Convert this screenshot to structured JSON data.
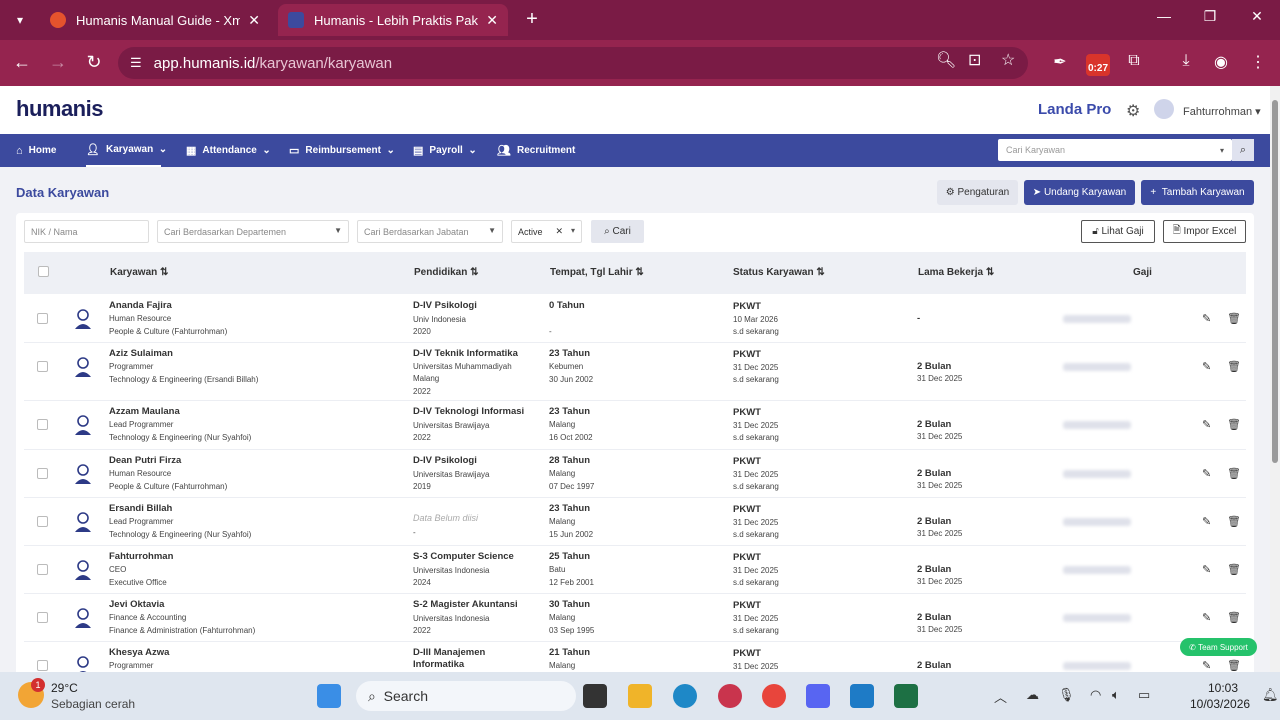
{
  "browser": {
    "tabs": [
      {
        "title": "Humanis Manual Guide - Xmind"
      },
      {
        "title": "Humanis - Lebih Praktis Pakai Humanis"
      }
    ],
    "url_domain": "app.humanis.id",
    "url_path": "/karyawan/karyawan",
    "ext_badge": "0:27"
  },
  "app": {
    "logo": "humanis",
    "company": "Landa Pro",
    "user": "Fahturrohman"
  },
  "nav": {
    "items": [
      "Home",
      "Karyawan",
      "Attendance",
      "Reimbursement",
      "Payroll",
      "Recruitment"
    ],
    "search_placeholder": "Cari Karyawan"
  },
  "page": {
    "title": "Data Karyawan",
    "btn_settings": "Pengaturan",
    "btn_invite": "Undang Karyawan",
    "btn_add": "Tambah Karyawan"
  },
  "filters": {
    "nik_placeholder": "NIK / Nama",
    "dept_placeholder": "Cari Berdasarkan Departemen",
    "job_placeholder": "Cari Berdasarkan Jabatan",
    "status_value": "Active",
    "search_btn": "Cari",
    "btn_salary": "Lihat Gaji",
    "btn_import": "Impor Excel"
  },
  "table": {
    "headers": [
      "Karyawan",
      "Pendidikan",
      "Tempat, Tgl Lahir",
      "Status Karyawan",
      "Lama Bekerja",
      "Gaji"
    ],
    "rows": [
      {
        "name": "Ananda Fajira",
        "role": "Human Resource",
        "dept": "People & Culture (Fahturrohman)",
        "edu": "D-IV Psikologi",
        "school": "Univ Indonesia",
        "year": "2020",
        "age": "0 Tahun",
        "city": "",
        "dob": "-",
        "status": "PKWT",
        "status_date": "10 Mar 2026",
        "status_until": "s.d sekarang",
        "tenure": "-",
        "tenure_date": ""
      },
      {
        "name": "Aziz Sulaiman",
        "role": "Programmer",
        "dept": "Technology & Engineering (Ersandi Billah)",
        "edu": "D-IV Teknik Informatika",
        "school": "Universitas Muhammadiyah Malang",
        "year": "2022",
        "age": "23 Tahun",
        "city": "Kebumen",
        "dob": "30 Jun 2002",
        "status": "PKWT",
        "status_date": "31 Dec 2025",
        "status_until": "s.d sekarang",
        "tenure": "2 Bulan",
        "tenure_date": "31 Dec 2025"
      },
      {
        "name": "Azzam Maulana",
        "role": "Lead Programmer",
        "dept": "Technology & Engineering (Nur Syahfoi)",
        "edu": "D-IV Teknologi Informasi",
        "school": "Universitas Brawijaya",
        "year": "2022",
        "age": "23 Tahun",
        "city": "Malang",
        "dob": "16 Oct 2002",
        "status": "PKWT",
        "status_date": "31 Dec 2025",
        "status_until": "s.d sekarang",
        "tenure": "2 Bulan",
        "tenure_date": "31 Dec 2025"
      },
      {
        "name": "Dean Putri Firza",
        "role": "Human Resource",
        "dept": "People & Culture (Fahturrohman)",
        "edu": "D-IV Psikologi",
        "school": "Universitas Brawijaya",
        "year": "2019",
        "age": "28 Tahun",
        "city": "Malang",
        "dob": "07 Dec 1997",
        "status": "PKWT",
        "status_date": "31 Dec 2025",
        "status_until": "s.d sekarang",
        "tenure": "2 Bulan",
        "tenure_date": "31 Dec 2025"
      },
      {
        "name": "Ersandi Billah",
        "role": "Lead Programmer",
        "dept": "Technology & Engineering (Nur Syahfoi)",
        "edu": "",
        "edu_empty": "Data Belum diisi",
        "school": "-",
        "year": "",
        "age": "23 Tahun",
        "city": "Malang",
        "dob": "15 Jun 2002",
        "status": "PKWT",
        "status_date": "31 Dec 2025",
        "status_until": "s.d sekarang",
        "tenure": "2 Bulan",
        "tenure_date": "31 Dec 2025"
      },
      {
        "name": "Fahturrohman",
        "role": "CEO",
        "dept": "Executive Office",
        "edu": "S-3 Computer Science",
        "school": "Universitas Indonesia",
        "year": "2024",
        "age": "25 Tahun",
        "city": "Batu",
        "dob": "12 Feb 2001",
        "status": "PKWT",
        "status_date": "31 Dec 2025",
        "status_until": "s.d sekarang",
        "tenure": "2 Bulan",
        "tenure_date": "31 Dec 2025"
      },
      {
        "name": "Jevi Oktavia",
        "role": "Finance & Accounting",
        "dept": "Finance & Administration (Fahturrohman)",
        "edu": "S-2 Magister Akuntansi",
        "school": "Universitas Indonesia",
        "year": "2022",
        "age": "30 Tahun",
        "city": "Malang",
        "dob": "03 Sep 1995",
        "status": "PKWT",
        "status_date": "31 Dec 2025",
        "status_until": "s.d sekarang",
        "tenure": "2 Bulan",
        "tenure_date": "31 Dec 2025"
      },
      {
        "name": "Khesya Azwa",
        "role": "Programmer",
        "dept": "",
        "edu": "D-III Manajemen Informatika",
        "school": "",
        "year": "",
        "age": "21 Tahun",
        "city": "Malang",
        "dob": "",
        "status": "PKWT",
        "status_date": "31 Dec 2025",
        "status_until": "",
        "tenure": "2 Bulan",
        "tenure_date": ""
      }
    ]
  },
  "team_support": "Team Support",
  "taskbar": {
    "temp": "29°C",
    "weather": "Sebagian cerah",
    "weather_badge": "1",
    "search": "Search",
    "time": "10:03",
    "date": "10/03/2026"
  },
  "colors": {
    "brand": "#3c4a9e",
    "chrome": "#95244f"
  }
}
